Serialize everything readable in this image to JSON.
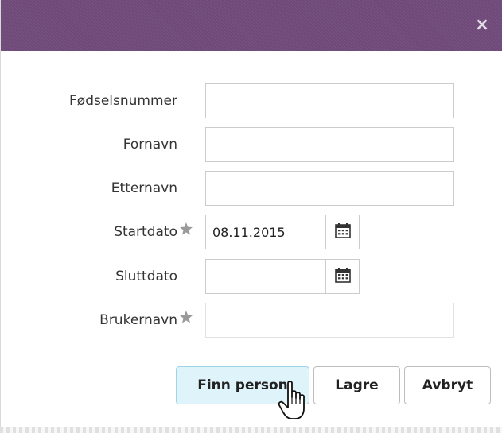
{
  "dialog": {
    "close_glyph": "×",
    "title_color": "#6f4a79"
  },
  "form": {
    "fields": [
      {
        "label": "Fødselsnummer",
        "value": "",
        "required": false
      },
      {
        "label": "Fornavn",
        "value": "",
        "required": false
      },
      {
        "label": "Etternavn",
        "value": "",
        "required": false
      },
      {
        "label": "Startdato",
        "value": "08.11.2015",
        "required": true
      },
      {
        "label": "Sluttdato",
        "value": "",
        "required": false
      },
      {
        "label": "Brukernavn",
        "value": "",
        "required": true
      }
    ],
    "calendar_icon": "calendar-icon",
    "required_icon": "star-icon"
  },
  "buttons": {
    "find_person": "Finn person",
    "save": "Lagre",
    "cancel": "Avbryt"
  },
  "cursor_icon": "hand-pointer-icon"
}
